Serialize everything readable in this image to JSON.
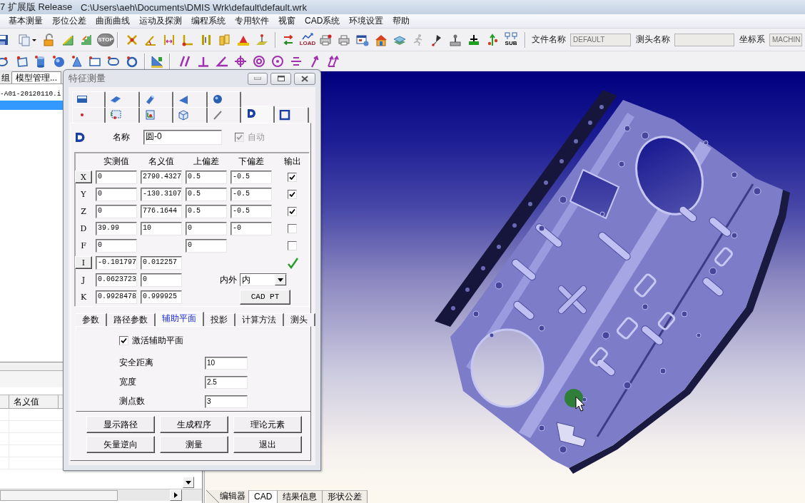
{
  "window": {
    "title": "7 扩展版 Release",
    "path": "C:\\Users\\aeh\\Documents\\DMIS Wrk\\default\\default.wrk"
  },
  "menu": [
    "基本测量",
    "形位公差",
    "曲面曲线",
    "运动及探测",
    "编程系统",
    "专用软件",
    "视窗",
    "CAD系统",
    "环境设置",
    "帮助"
  ],
  "toolbar": {
    "stop_button": "STOP",
    "load_button": "LOAD",
    "sub_button": "SUB",
    "fields": [
      {
        "label": "文件名称",
        "value": "DEFAULT",
        "disabled": true
      },
      {
        "label": "测头名称",
        "disabled": true
      },
      {
        "label": "坐标系",
        "value": "MACHIN",
        "disabled": true
      }
    ]
  },
  "left_panel": {
    "tabs": [
      {
        "label": "组",
        "selected": false
      },
      {
        "label": "模型管理...",
        "selected": true
      }
    ],
    "tree": [
      {
        "label": "-A01-20120110.i",
        "selected": false
      },
      {
        "selected": true
      }
    ],
    "table": {
      "columns": [
        "名义值"
      ]
    }
  },
  "dialog": {
    "title": "特征测量",
    "feature_tabs": [
      [
        {
          "selected": false
        },
        {
          "selected": false
        },
        {
          "selected": false
        },
        {
          "selected": false
        },
        {
          "selected": false
        }
      ],
      [
        {
          "selected": false
        },
        {
          "selected": false
        },
        {
          "selected": false
        },
        {
          "selected": false
        },
        {
          "selected": false
        },
        {
          "selected": true
        },
        {
          "selected": false
        }
      ]
    ],
    "name": {
      "label": "名称",
      "value": "圆-0"
    },
    "auto": {
      "label": "自动",
      "checked": true,
      "disabled": true
    },
    "columns": [
      "实测值",
      "名义值",
      "上偏差",
      "下偏差",
      "输出"
    ],
    "rows": [
      {
        "label": "X",
        "kind": "button",
        "actual": "0",
        "nominal": "2790.4327",
        "upper": "0.5",
        "lower": "-0.5",
        "output": {
          "kind": "checkbox",
          "checked": true
        }
      },
      {
        "label": "Y",
        "kind": "label",
        "actual": "0",
        "nominal": "-130.3107",
        "upper": "0.5",
        "lower": "-0.5",
        "output": {
          "kind": "checkbox",
          "checked": true
        }
      },
      {
        "label": "Z",
        "kind": "label",
        "actual": "0",
        "nominal": "776.1644",
        "upper": "0.5",
        "lower": "-0.5",
        "output": {
          "kind": "checkbox",
          "checked": true
        }
      },
      {
        "label": "D",
        "kind": "label",
        "actual": "39.99",
        "nominal": "10",
        "upper": "0",
        "lower": "-0",
        "output": {
          "kind": "checkbox",
          "checked": false
        }
      },
      {
        "label": "F",
        "kind": "label",
        "actual": "0",
        "upper": "0",
        "output": {
          "kind": "checkbox",
          "checked": false
        }
      },
      {
        "label": "I",
        "kind": "button",
        "actual": "-0.101797",
        "nominal": "0.012257",
        "output": {
          "kind": "tick"
        }
      },
      {
        "label": "J",
        "kind": "label",
        "actual": "0.0623723",
        "nominal": "0"
      },
      {
        "label": "K",
        "kind": "label",
        "actual": "0.9928478",
        "nominal": "0.999925"
      }
    ],
    "inside_outside": {
      "label": "内外",
      "value": "内"
    },
    "cad_pt_button": "CAD PT",
    "sub_tabs": [
      {
        "label": "参数",
        "selected": false
      },
      {
        "label": "路径参数",
        "selected": false
      },
      {
        "label": "辅助平面",
        "selected": true
      },
      {
        "label": "投影",
        "selected": false
      },
      {
        "label": "计算方法",
        "selected": false
      },
      {
        "label": "测头",
        "selected": false
      }
    ],
    "aux_plane": {
      "activate": {
        "label": "激活辅助平面",
        "checked": true
      },
      "fields": [
        {
          "label": "安全距离",
          "value": "10"
        },
        {
          "label": "宽度",
          "value": "2.5"
        },
        {
          "label": "测点数",
          "value": "3"
        }
      ]
    },
    "buttons": [
      [
        "显示路径",
        "生成程序",
        "理论元素"
      ],
      [
        "矢量逆向",
        "测量",
        "退出"
      ]
    ]
  },
  "bottom_tabs": [
    {
      "label": "编辑器",
      "selected": false
    },
    {
      "label": "CAD",
      "selected": true
    },
    {
      "label": "结果信息",
      "selected": false
    },
    {
      "label": "形状公差",
      "selected": false
    }
  ]
}
